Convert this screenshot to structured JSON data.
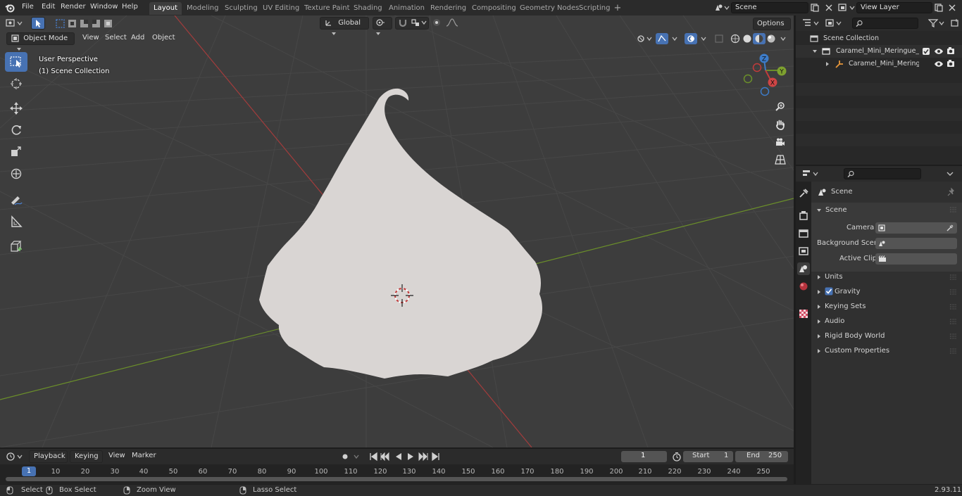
{
  "topbar": {
    "menus": [
      "File",
      "Edit",
      "Render",
      "Window",
      "Help"
    ],
    "workspaces": [
      "Layout",
      "Modeling",
      "Sculpting",
      "UV Editing",
      "Texture Paint",
      "Shading",
      "Animation",
      "Rendering",
      "Compositing",
      "Geometry Nodes",
      "Scripting"
    ],
    "active_workspace": "Layout",
    "scene_name": "Scene",
    "view_layer_name": "View Layer"
  },
  "viewport": {
    "mode": "Object Mode",
    "menus": [
      "View",
      "Select",
      "Add",
      "Object"
    ],
    "transform_orientation": "Global",
    "options_label": "Options",
    "info_line1": "User Perspective",
    "info_line2": "(1) Scene Collection",
    "gizmo_axes": [
      "X",
      "Y",
      "Z"
    ]
  },
  "timeline": {
    "menus": [
      "Playback",
      "Keying",
      "View",
      "Marker"
    ],
    "current_frame": "1",
    "start_label": "Start",
    "start_value": "1",
    "end_label": "End",
    "end_value": "250",
    "ruler_labels": [
      "1",
      "10",
      "20",
      "30",
      "40",
      "50",
      "60",
      "70",
      "80",
      "90",
      "100",
      "110",
      "120",
      "130",
      "140",
      "150",
      "160",
      "170",
      "180",
      "190",
      "200",
      "210",
      "220",
      "230",
      "240",
      "250"
    ]
  },
  "statusbar": {
    "select": "Select",
    "box_select": "Box Select",
    "zoom_view": "Zoom View",
    "lasso_select": "Lasso Select",
    "version": "2.93.11"
  },
  "outliner": {
    "root": "Scene Collection",
    "collection": "Caramel_Mini_Meringue_Cool",
    "object": "Caramel_Mini_Meringue_"
  },
  "properties": {
    "context_title": "Scene",
    "panel_scene": "Scene",
    "camera_label": "Camera",
    "background_scene_label": "Background Scene",
    "active_clip_label": "Active Clip",
    "panels": [
      "Units",
      "Gravity",
      "Keying Sets",
      "Audio",
      "Rigid Body World",
      "Custom Properties"
    ]
  },
  "colors": {
    "accent": "#4772b3",
    "viewport_bg": "#3d3d3d",
    "x_axis": "#a33c3c",
    "y_axis": "#6b8f2a",
    "mesh": "#d9d5d3"
  }
}
